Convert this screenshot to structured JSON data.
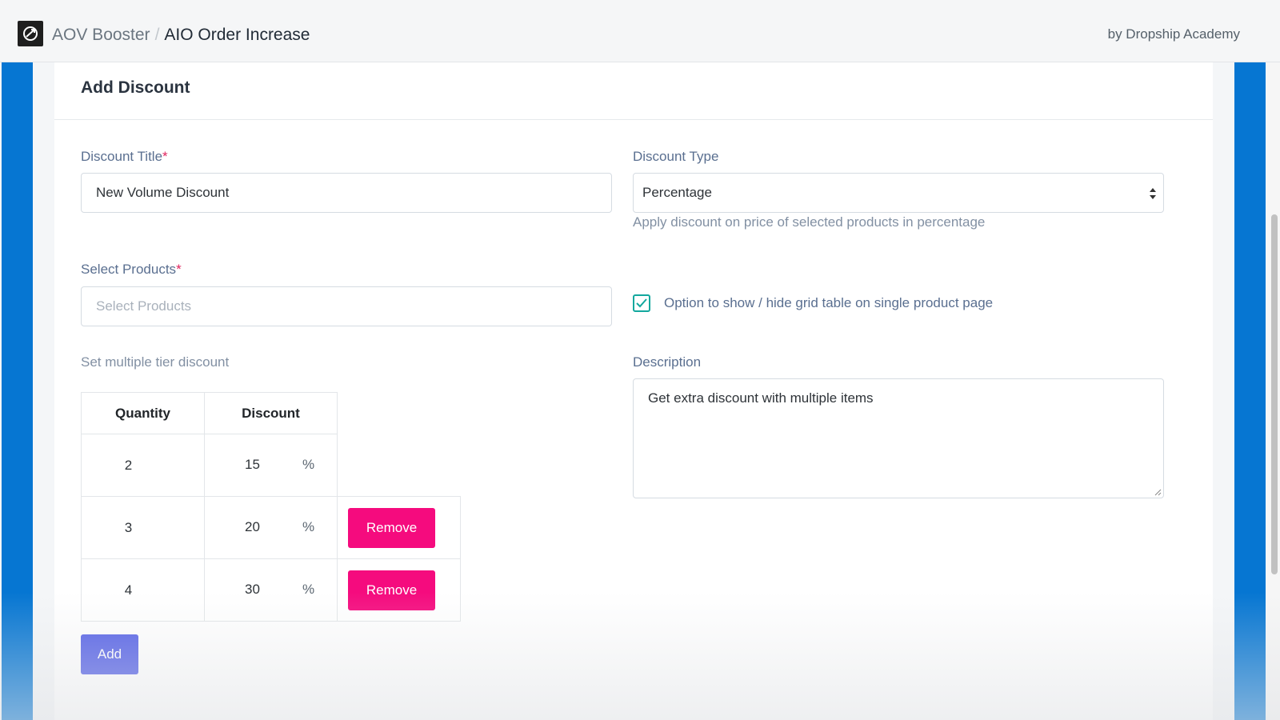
{
  "topbar": {
    "app_name": "AOV Booster",
    "separator": "/",
    "page_name": "AIO Order Increase",
    "byline": "by Dropship Academy",
    "logo_icon": "aov-booster-logo-icon"
  },
  "card": {
    "title": "Add Discount"
  },
  "form": {
    "discount_title": {
      "label": "Discount Title",
      "required_mark": "*",
      "value": "New Volume Discount"
    },
    "discount_type": {
      "label": "Discount Type",
      "value": "Percentage",
      "help": "Apply discount on price of selected products in percentage"
    },
    "select_products": {
      "label": "Select Products",
      "required_mark": "*",
      "placeholder": "Select Products"
    },
    "grid_option": {
      "checked": true,
      "label": "Option to show / hide grid table on single product page"
    },
    "description": {
      "label": "Description",
      "value": "Get extra discount with multiple items"
    },
    "tiers": {
      "label": "Set multiple tier discount",
      "headers": [
        "Quantity",
        "Discount"
      ],
      "rows": [
        {
          "quantity": "2",
          "discount": "15",
          "unit": "%",
          "remove": ""
        },
        {
          "quantity": "3",
          "discount": "20",
          "unit": "%",
          "remove": "Remove"
        },
        {
          "quantity": "4",
          "discount": "30",
          "unit": "%",
          "remove": "Remove"
        }
      ],
      "add_label": "Add"
    }
  },
  "colors": {
    "side_bar": "#0676d2",
    "remove_button": "#f50b7e",
    "add_button": "#5561e6",
    "checkbox": "#13a89e",
    "required": "#e0245e"
  }
}
